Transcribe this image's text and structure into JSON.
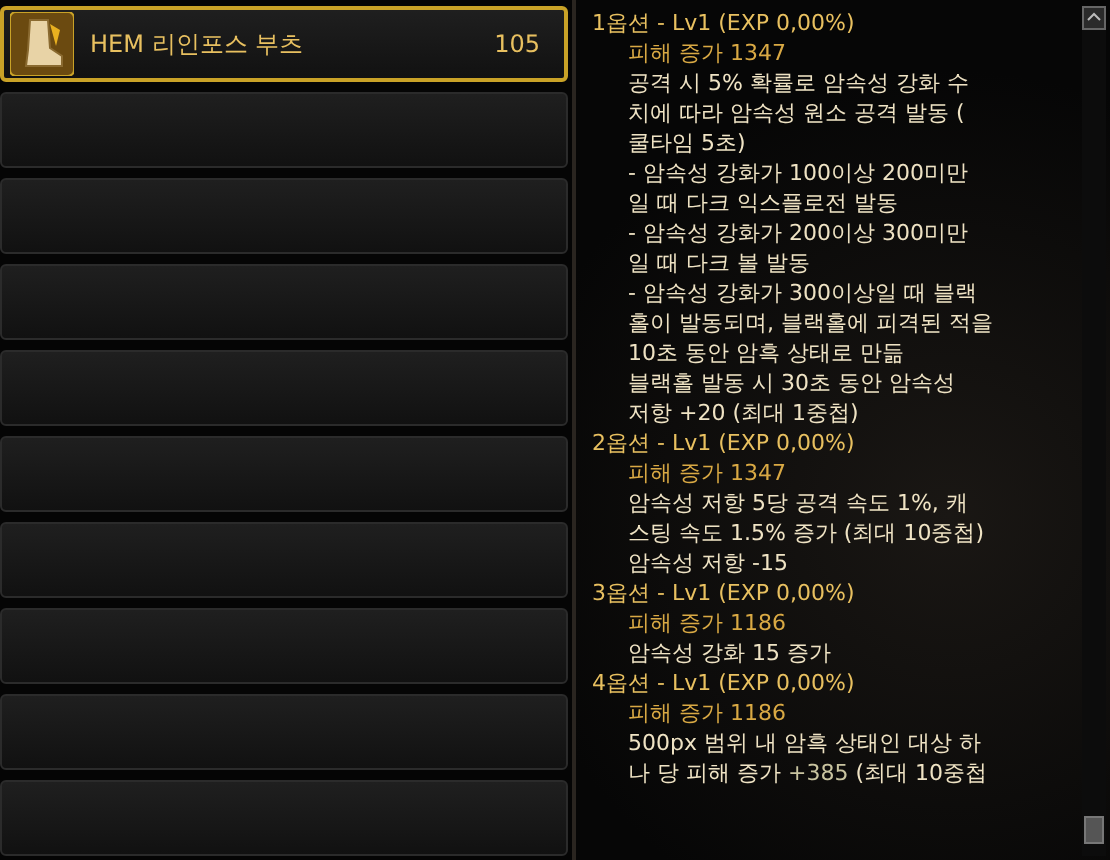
{
  "item_slots": [
    {
      "name": "HEM 리인포스 부츠",
      "value": "105",
      "selected": true,
      "kind": "item"
    },
    {
      "selected": false,
      "kind": "empty"
    },
    {
      "selected": false,
      "kind": "empty"
    },
    {
      "selected": false,
      "kind": "empty"
    },
    {
      "selected": false,
      "kind": "empty"
    },
    {
      "selected": false,
      "kind": "empty"
    },
    {
      "selected": false,
      "kind": "empty"
    },
    {
      "selected": false,
      "kind": "empty"
    },
    {
      "selected": false,
      "kind": "empty"
    },
    {
      "selected": false,
      "kind": "empty"
    }
  ],
  "options": [
    {
      "header": "1옵션 - Lv1 (EXP 0,00%)",
      "lines": [
        {
          "kind": "stat",
          "text": "피해 증가 1347"
        },
        {
          "kind": "desc",
          "text": "공격 시 5% 확률로 암속성 강화 수"
        },
        {
          "kind": "desc",
          "text": "치에 따라 암속성 원소 공격 발동 ("
        },
        {
          "kind": "desc",
          "text": "쿨타임 5초)"
        },
        {
          "kind": "desc",
          "text": "- 암속성 강화가 100이상 200미만"
        },
        {
          "kind": "desc",
          "text": "일 때 다크 익스플로전 발동"
        },
        {
          "kind": "desc",
          "text": "- 암속성 강화가 200이상 300미만"
        },
        {
          "kind": "desc",
          "text": "일 때 다크 볼 발동"
        },
        {
          "kind": "desc",
          "text": "- 암속성 강화가 300이상일 때 블랙"
        },
        {
          "kind": "desc",
          "text": "홀이 발동되며, 블랙홀에 피격된 적을"
        },
        {
          "kind": "desc",
          "text": "10초 동안 암흑 상태로 만듦"
        },
        {
          "kind": "desc",
          "text": "블랙홀 발동 시 30초 동안 암속성"
        },
        {
          "kind": "desc",
          "text": "저항 +20 (최대 1중첩)"
        }
      ]
    },
    {
      "header": "2옵션 - Lv1 (EXP 0,00%)",
      "lines": [
        {
          "kind": "stat",
          "text": "피해 증가 1347"
        },
        {
          "kind": "desc",
          "text": "암속성 저항 5당 공격 속도 1%, 캐"
        },
        {
          "kind": "desc",
          "text": "스팅 속도 1.5% 증가 (최대 10중첩)"
        },
        {
          "kind": "desc",
          "text": "암속성 저항 -15"
        }
      ]
    },
    {
      "header": "3옵션 - Lv1 (EXP 0,00%)",
      "lines": [
        {
          "kind": "stat",
          "text": "피해 증가 1186"
        },
        {
          "kind": "desc",
          "text": "암속성 강화 15 증가"
        }
      ]
    },
    {
      "header": "4옵션 - Lv1 (EXP 0,00%)",
      "lines": [
        {
          "kind": "stat",
          "text": "피해 증가 1186"
        },
        {
          "kind": "desc",
          "text": "500px 범위 내 암흑 상태인 대상 하"
        },
        {
          "kind": "desc",
          "segments": [
            {
              "text": "나 당 피해 증가 ",
              "highlight": false
            },
            {
              "text": "+385",
              "highlight": true
            },
            {
              "text": " (최대 10중첩",
              "highlight": false
            }
          ]
        }
      ]
    }
  ]
}
